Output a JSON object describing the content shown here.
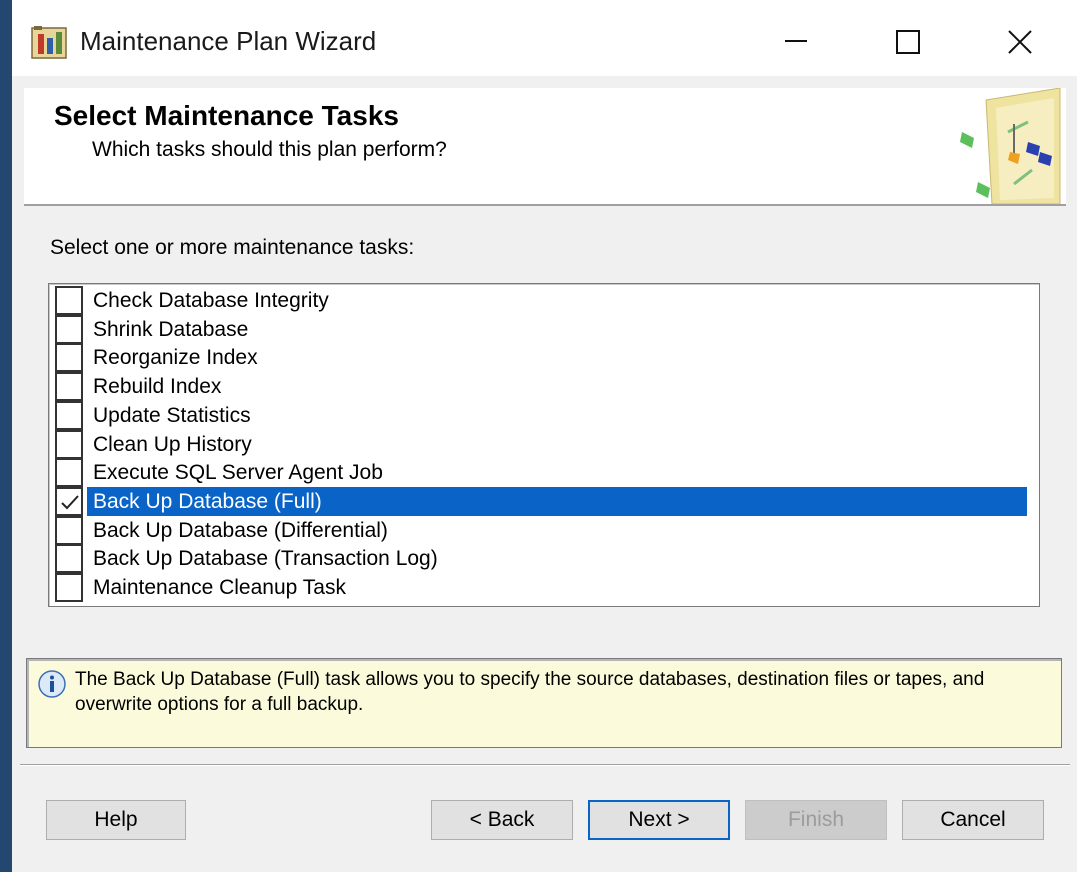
{
  "window": {
    "title": "Maintenance Plan Wizard",
    "controls": [
      "minimize",
      "maximize",
      "close"
    ]
  },
  "header": {
    "title": "Select Maintenance Tasks",
    "subtitle": "Which tasks should this plan perform?"
  },
  "task_list": {
    "caption": "Select one or more maintenance tasks:",
    "items": [
      {
        "label": "Check Database Integrity",
        "checked": false,
        "selected": false
      },
      {
        "label": "Shrink Database",
        "checked": false,
        "selected": false
      },
      {
        "label": "Reorganize Index",
        "checked": false,
        "selected": false
      },
      {
        "label": "Rebuild Index",
        "checked": false,
        "selected": false
      },
      {
        "label": "Update Statistics",
        "checked": false,
        "selected": false
      },
      {
        "label": "Clean Up History",
        "checked": false,
        "selected": false
      },
      {
        "label": "Execute SQL Server Agent Job",
        "checked": false,
        "selected": false
      },
      {
        "label": "Back Up Database (Full)",
        "checked": true,
        "selected": true
      },
      {
        "label": "Back Up Database (Differential)",
        "checked": false,
        "selected": false
      },
      {
        "label": "Back Up Database (Transaction Log)",
        "checked": false,
        "selected": false
      },
      {
        "label": "Maintenance Cleanup Task",
        "checked": false,
        "selected": false
      }
    ]
  },
  "info": {
    "icon": "info-icon",
    "text": "The Back Up Database (Full) task allows you to specify the source databases, destination files or tapes, and overwrite options for a full backup."
  },
  "buttons": {
    "help": "Help",
    "back": "< Back",
    "next": "Next >",
    "finish": "Finish",
    "cancel": "Cancel"
  },
  "colors": {
    "selection": "#0a64c8",
    "info_background": "#fbfbdc",
    "window_background": "#f0f0f0"
  }
}
